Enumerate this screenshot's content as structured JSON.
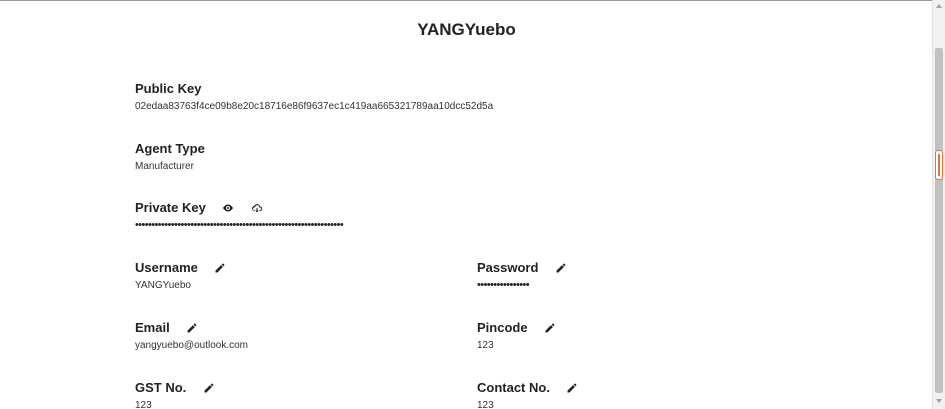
{
  "profile": {
    "title": "YANGYuebo"
  },
  "fields": {
    "public_key": {
      "label": "Public Key",
      "value": "02edaa83763f4ce09b8e20c18716e86f9637ec1c419aa665321789aa10dcc52d5a"
    },
    "agent_type": {
      "label": "Agent Type",
      "value": "Manufacturer"
    },
    "private_key": {
      "label": "Private Key",
      "value": "••••••••••••••••••••••••••••••••••••••••••••••••••••••••••••••••"
    },
    "username": {
      "label": "Username",
      "value": "YANGYuebo"
    },
    "password": {
      "label": "Password",
      "value": "••••••••••••••••"
    },
    "email": {
      "label": "Email",
      "value": "yangyuebo@outlook.com"
    },
    "pincode": {
      "label": "Pincode",
      "value": "123"
    },
    "gst_no": {
      "label": "GST No.",
      "value": "123"
    },
    "contact_no": {
      "label": "Contact No.",
      "value": "123"
    }
  },
  "icons": {
    "edit": "pencil-icon",
    "reveal": "eye-icon",
    "download": "cloud-download-icon"
  },
  "colors": {
    "scroll_marker": "#e07a3a"
  }
}
